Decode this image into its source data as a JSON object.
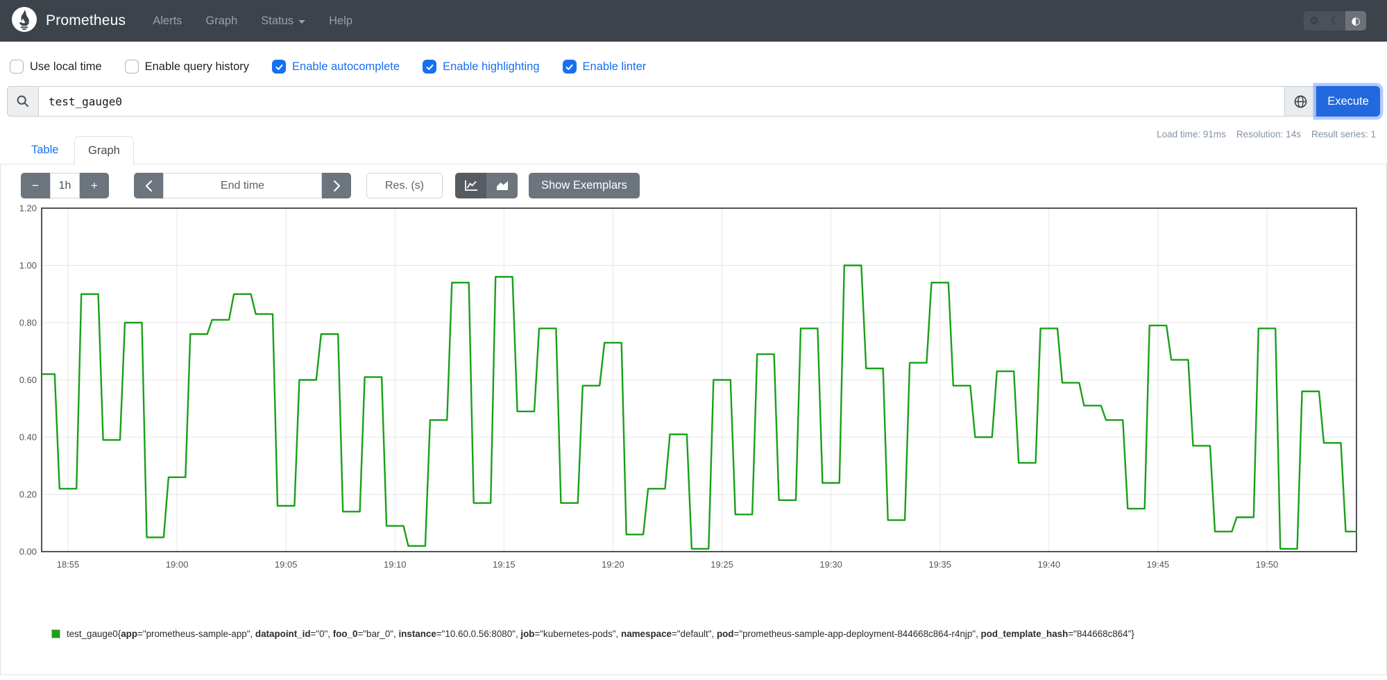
{
  "navbar": {
    "brand": "Prometheus",
    "items": [
      {
        "label": "Alerts"
      },
      {
        "label": "Graph"
      },
      {
        "label": "Status",
        "has_caret": true
      },
      {
        "label": "Help"
      }
    ],
    "theme_buttons": [
      {
        "icon": "gear-icon",
        "glyph": "⚙",
        "active": false
      },
      {
        "icon": "moon-icon",
        "glyph": "☾",
        "active": false
      },
      {
        "icon": "contrast-icon",
        "glyph": "◐",
        "active": true
      }
    ]
  },
  "options": [
    {
      "label": "Use local time",
      "checked": false
    },
    {
      "label": "Enable query history",
      "checked": false
    },
    {
      "label": "Enable autocomplete",
      "checked": true
    },
    {
      "label": "Enable highlighting",
      "checked": true
    },
    {
      "label": "Enable linter",
      "checked": true
    }
  ],
  "query": {
    "value": "test_gauge0",
    "execute_label": "Execute",
    "icons": [
      "search-icon",
      "globe-icon"
    ]
  },
  "stats": {
    "load_time": "Load time: 91ms",
    "resolution": "Resolution: 14s",
    "result_series": "Result series: 1"
  },
  "tabs": [
    {
      "label": "Table",
      "active": false
    },
    {
      "label": "Graph",
      "active": true
    }
  ],
  "graph_controls": {
    "minus_label": "−",
    "range_value": "1h",
    "plus_label": "+",
    "end_time_placeholder": "End time",
    "res_placeholder": "Res. (s)",
    "chart_type_icons": [
      "line-chart-icon",
      "stacked-chart-icon"
    ],
    "active_chart_type": "line",
    "show_exemplars_label": "Show Exemplars"
  },
  "colors": {
    "accent_blue": "#1670f0",
    "execute_blue": "#2268df",
    "navbar_bg": "#3d434b",
    "button_gray": "#6c757d",
    "series_green": "#18a018"
  },
  "chart_data": {
    "type": "line",
    "step": true,
    "title": "",
    "xlabel": "",
    "ylabel": "",
    "ylim": [
      0,
      1.2
    ],
    "grid": true,
    "y_ticks": [
      "0.00",
      "0.20",
      "0.40",
      "0.60",
      "0.80",
      "1.00",
      "1.20"
    ],
    "x_tick_labels": [
      "18:55",
      "19:00",
      "19:05",
      "19:10",
      "19:15",
      "19:20",
      "19:25",
      "19:30",
      "19:35",
      "19:40",
      "19:45",
      "19:50"
    ],
    "x_tick_interval_minutes": 5,
    "sample_interval_minutes": 1,
    "first_plateau_start_min": -1.5,
    "window_minutes": [
      -1.21,
      59.13
    ],
    "legend_position": "bottom-left",
    "series": [
      {
        "name": "test_gauge0{app=\"prometheus-sample-app\", datapoint_id=\"0\", foo_0=\"bar_0\", instance=\"10.60.0.56:8080\", job=\"kubernetes-pods\", namespace=\"default\", pod=\"prometheus-sample-app-deployment-844668c864-r4njp\", pod_template_hash=\"844668c864\"}",
        "color": "#18a018",
        "values": [
          0.62,
          0.22,
          0.9,
          0.39,
          0.8,
          0.05,
          0.26,
          0.76,
          0.81,
          0.9,
          0.83,
          0.16,
          0.6,
          0.76,
          0.14,
          0.61,
          0.09,
          0.02,
          0.46,
          0.94,
          0.17,
          0.96,
          0.49,
          0.78,
          0.17,
          0.58,
          0.73,
          0.06,
          0.22,
          0.41,
          0.01,
          0.6,
          0.13,
          0.69,
          0.18,
          0.78,
          0.24,
          1.0,
          0.64,
          0.11,
          0.66,
          0.94,
          0.58,
          0.4,
          0.63,
          0.31,
          0.78,
          0.59,
          0.51,
          0.46,
          0.15,
          0.79,
          0.67,
          0.37,
          0.07,
          0.12,
          0.78,
          0.01,
          0.56,
          0.38,
          0.07
        ]
      }
    ]
  },
  "legend": {
    "metric": "test_gauge0",
    "swatch_color": "#18a018",
    "labels": [
      {
        "name": "app",
        "value": "prometheus-sample-app"
      },
      {
        "name": "datapoint_id",
        "value": "0"
      },
      {
        "name": "foo_0",
        "value": "bar_0"
      },
      {
        "name": "instance",
        "value": "10.60.0.56:8080"
      },
      {
        "name": "job",
        "value": "kubernetes-pods"
      },
      {
        "name": "namespace",
        "value": "default"
      },
      {
        "name": "pod",
        "value": "prometheus-sample-app-deployment-844668c864-r4njp"
      },
      {
        "name": "pod_template_hash",
        "value": "844668c864"
      }
    ]
  }
}
